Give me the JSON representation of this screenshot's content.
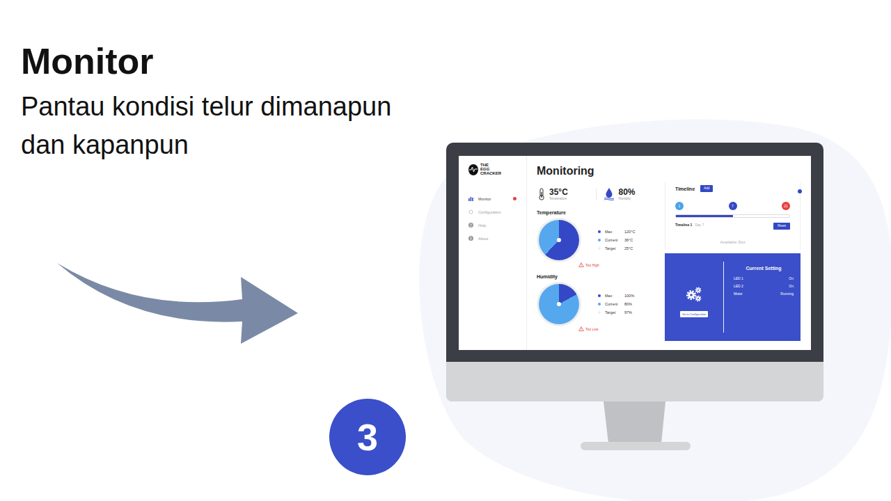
{
  "slide": {
    "title": "Monitor",
    "subtitle": "Pantau kondisi telur dimanapun dan kapanpun",
    "step": "3"
  },
  "app": {
    "logo": [
      "THE",
      "EGG",
      "CRACKER"
    ],
    "sidebar": {
      "items": [
        {
          "label": "Monitor",
          "selected": true,
          "alert": true
        },
        {
          "label": "Configuration",
          "selected": false,
          "alert": false
        },
        {
          "label": "Help",
          "selected": false,
          "alert": false
        },
        {
          "label": "About",
          "selected": false,
          "alert": false
        }
      ]
    },
    "page_title": "Monitoring",
    "stats": [
      {
        "value": "35°C",
        "label": "Temperature",
        "kind": "thermometer"
      },
      {
        "value": "80%",
        "label": "Humidity",
        "kind": "drop"
      }
    ],
    "gauges": [
      {
        "title": "Temperature",
        "level": 0.62,
        "warning": "Too High",
        "legend": [
          {
            "label": "Max",
            "value": "120°C",
            "color": "#3448c5"
          },
          {
            "label": "Current",
            "value": "36°C",
            "color": "#56a8ee"
          },
          {
            "label": "Target",
            "value": "25°C",
            "color": "#eeeeee"
          }
        ]
      },
      {
        "title": "Humidity",
        "level": 0.17,
        "warning": "Too Low",
        "legend": [
          {
            "label": "Max",
            "value": "100%",
            "color": "#3448c5"
          },
          {
            "label": "Current",
            "value": "80%",
            "color": "#56a8ee"
          },
          {
            "label": "Target",
            "value": "97%",
            "color": "#eeeeee"
          }
        ]
      }
    ],
    "timeline": {
      "title": "Timeline",
      "add_button": "Add",
      "markers": [
        {
          "label": "1",
          "color": "#4aa3ea"
        },
        {
          "label": "7",
          "color": "#3448c5"
        },
        {
          "label": "21",
          "color": "#e8403f"
        }
      ],
      "level": 0.5,
      "name": "Timeline 1",
      "day": "Day 7",
      "reset_button": "Reset",
      "empty_slot": "Available Slot"
    },
    "settings": {
      "button": "Go to Configuration",
      "title": "Current Setting",
      "rows": [
        {
          "name": "LED 1",
          "value": "On"
        },
        {
          "name": "LED 2",
          "value": "On"
        },
        {
          "name": "Motor",
          "value": "Running"
        }
      ]
    }
  }
}
